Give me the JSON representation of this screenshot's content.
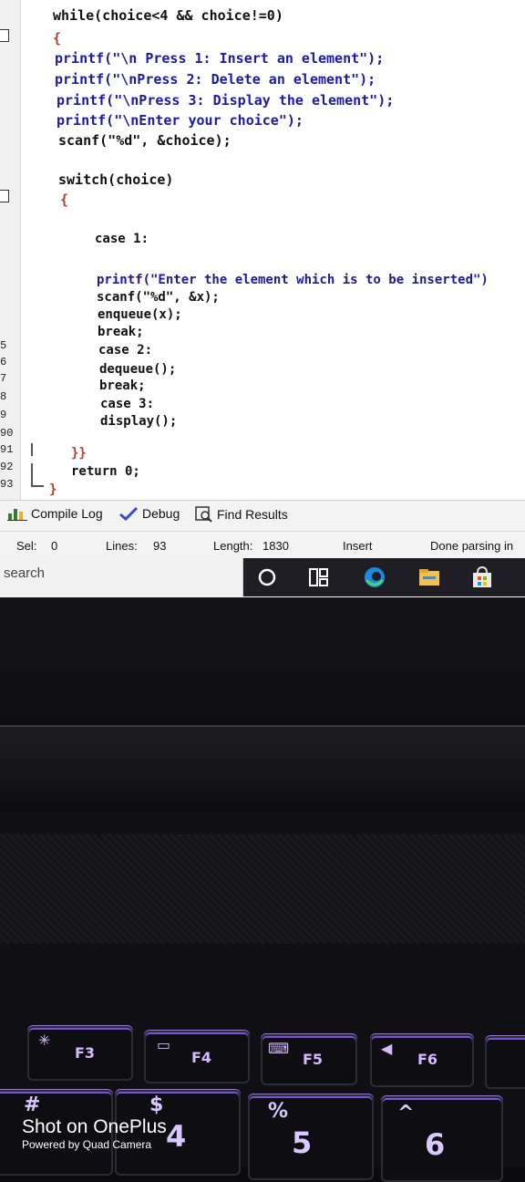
{
  "editor": {
    "lines": [
      {
        "num": "",
        "text": "while(choice<4 && choice!=0)"
      },
      {
        "num": "",
        "text": "{"
      },
      {
        "num": "",
        "text": "printf(\"\\n Press 1: Insert an element\");"
      },
      {
        "num": "",
        "text": "printf(\"\\nPress 2: Delete an element\");"
      },
      {
        "num": "",
        "text": "printf(\"\\nPress 3: Display the element\");"
      },
      {
        "num": "",
        "text": "printf(\"\\nEnter your choice\");"
      },
      {
        "num": "",
        "text": "scanf(\"%d\", &choice);"
      },
      {
        "num": "",
        "text": "switch(choice)"
      },
      {
        "num": "",
        "text": "{"
      },
      {
        "num": "",
        "text": "case 1:"
      },
      {
        "num": "",
        "text": "printf(\"Enter the element which is to be inserted\")"
      },
      {
        "num": "",
        "text": "scanf(\"%d\", &x);"
      },
      {
        "num": "",
        "text": "enqueue(x);"
      },
      {
        "num": "",
        "text": "break;"
      },
      {
        "num": "",
        "text": "case 2:"
      },
      {
        "num": "",
        "text": "dequeue();"
      },
      {
        "num": "",
        "text": "break;"
      },
      {
        "num": "",
        "text": "case 3:"
      },
      {
        "num": "",
        "text": "display();"
      },
      {
        "num": "",
        "text": "}}"
      },
      {
        "num": "",
        "text": "return 0;"
      },
      {
        "num": "",
        "text": "}"
      }
    ],
    "gutter_numbers": [
      "5",
      "6",
      "7",
      "8",
      "9",
      "90",
      "91",
      "92",
      "93"
    ]
  },
  "tabs": {
    "compile_log": "Compile Log",
    "debug": "Debug",
    "find_results": "Find Results"
  },
  "status": {
    "sel_label": "Sel:",
    "sel_value": "0",
    "lines_label": "Lines:",
    "lines_value": "93",
    "length_label": "Length:",
    "length_value": "1830",
    "mode": "Insert",
    "parse": "Done parsing in"
  },
  "taskbar": {
    "search_placeholder": "search"
  },
  "keyboard": {
    "keys": [
      "F3",
      "F4",
      "F5",
      "F6"
    ],
    "digits": [
      "4",
      "5",
      "6"
    ],
    "symbols": [
      "#",
      "$",
      "%"
    ]
  },
  "watermark": {
    "title": "Shot on OnePlus",
    "subtitle": "Powered by Quad Camera"
  },
  "colors": {
    "string": "#1a1aa6",
    "number": "#8a2be2",
    "brace": "#c0392b",
    "key_glow": "#b98bff"
  }
}
